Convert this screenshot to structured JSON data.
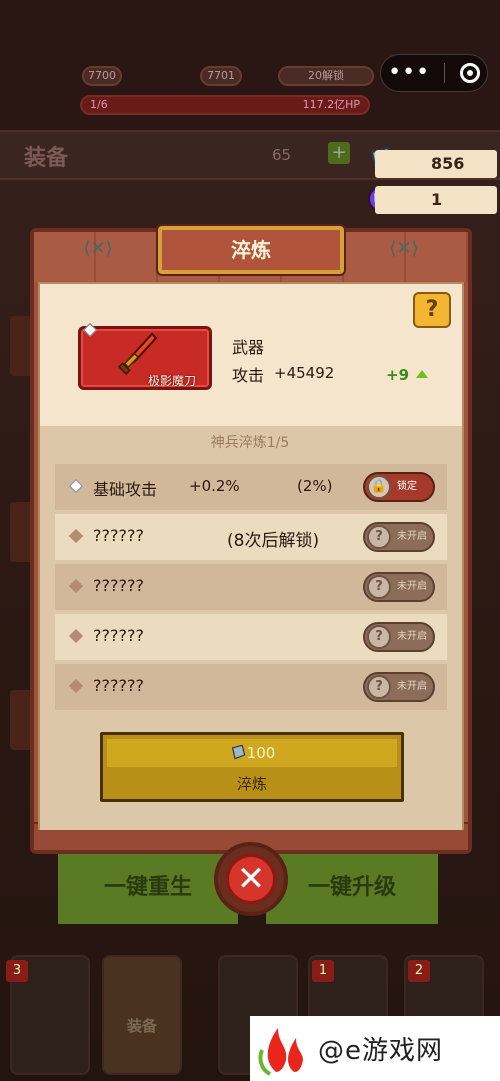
{
  "background": {
    "stats": [
      "7700",
      "7701",
      "20解锁"
    ],
    "hp": {
      "left": "1/6",
      "value": "117.2亿HP"
    },
    "equip_title": "装备",
    "equip_count": "65",
    "resources": [
      {
        "icon": "crystal-icon",
        "value": "856"
      },
      {
        "icon": "orb-icon",
        "value": "1"
      }
    ],
    "buttons": [
      "一键重生",
      "一键升级"
    ],
    "bottom_tabs": [
      {
        "badge": "3",
        "label": ""
      },
      {
        "badge": "",
        "label": "装备"
      },
      {
        "badge": "",
        "label": ""
      },
      {
        "badge": "1",
        "label": ""
      },
      {
        "badge": "2",
        "label": ""
      }
    ]
  },
  "modal": {
    "title": "淬炼",
    "help": "?",
    "item": {
      "name": "极影魔刀",
      "type": "武器",
      "stat_label": "攻击",
      "stat_value": "+45492",
      "level": "+9"
    },
    "subtitle": "神兵淬炼1/5",
    "rows": [
      {
        "name": "基础攻击",
        "value": "+0.2%",
        "chance": "(2%)",
        "button": "锁定",
        "button_icon": "lock-icon"
      },
      {
        "name": "??????",
        "value": "(8次后解锁)",
        "chance": "",
        "button": "未开启",
        "button_icon": "?"
      },
      {
        "name": "??????",
        "value": "",
        "chance": "",
        "button": "未开启",
        "button_icon": "?"
      },
      {
        "name": "??????",
        "value": "",
        "chance": "",
        "button": "未开启",
        "button_icon": "?"
      },
      {
        "name": "??????",
        "value": "",
        "chance": "",
        "button": "未开启",
        "button_icon": "?"
      }
    ],
    "temper_button": {
      "cost": "100",
      "label": "淬炼"
    }
  },
  "watermark": {
    "text": "@e游戏网"
  },
  "colors": {
    "accent_red": "#c82a26",
    "gold": "#b89018",
    "frame": "#a0533e"
  }
}
